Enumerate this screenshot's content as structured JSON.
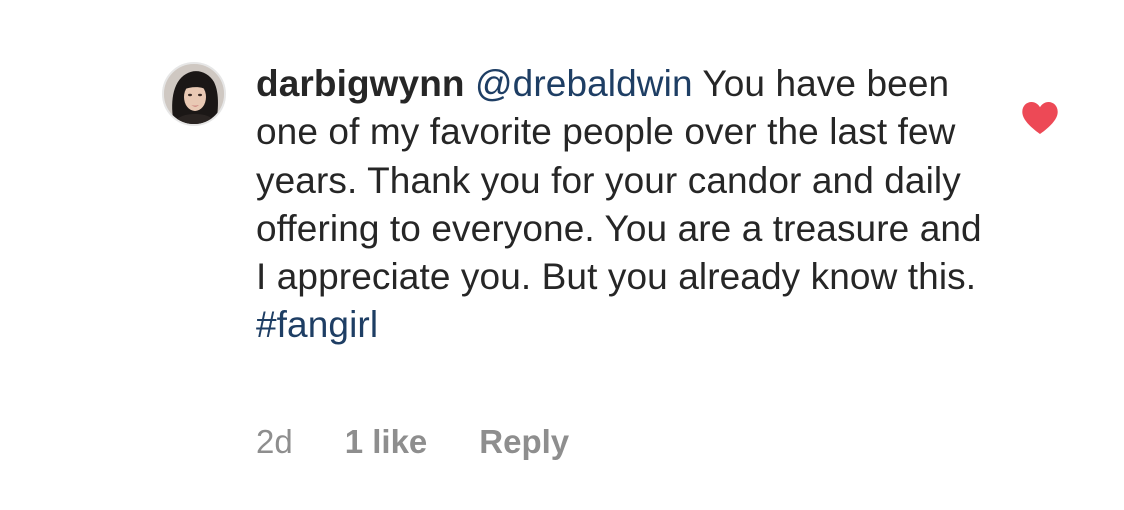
{
  "comment": {
    "username": "darbigwynn",
    "mention": "@drebaldwin",
    "text_part1": " You have been one of my favorite people over the last few years. Thank you for your candor and daily offering to everyone. You are a treasure and I appreciate you. But you already know this. ",
    "hashtag": "#fangirl",
    "liked": true,
    "heart_color": "#ed4956",
    "link_color": "#1e3e64",
    "heart_icon": "heart-filled-icon"
  },
  "meta": {
    "age": "2d",
    "likes": "1 like",
    "reply": "Reply"
  }
}
